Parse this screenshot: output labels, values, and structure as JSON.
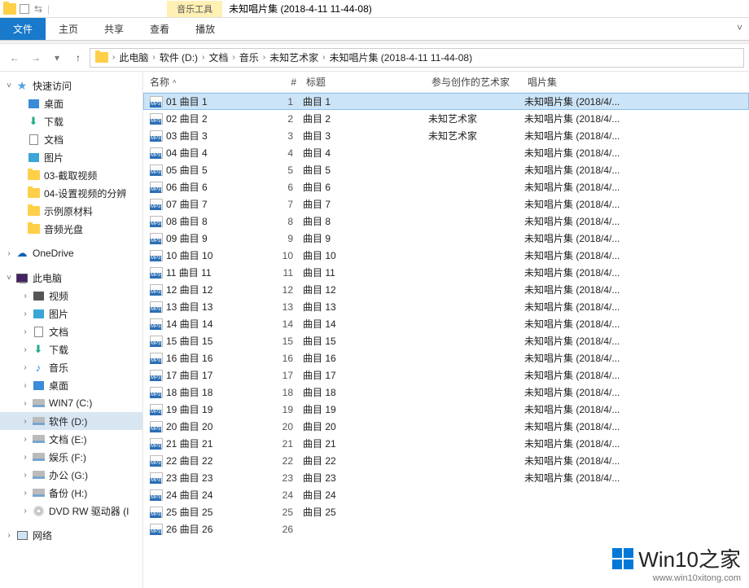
{
  "titlebar": {
    "context_tab": "音乐工具",
    "window_title": "未知唱片集 (2018-4-11 11-44-08)"
  },
  "ribbon": {
    "file": "文件",
    "tabs": [
      "主页",
      "共享",
      "查看",
      "播放"
    ]
  },
  "breadcrumb": [
    "此电脑",
    "软件 (D:)",
    "文档",
    "音乐",
    "未知艺术家",
    "未知唱片集 (2018-4-11 11-44-08)"
  ],
  "columns": {
    "name": "名称",
    "num": "#",
    "title": "标题",
    "artist": "参与创作的艺术家",
    "album": "唱片集"
  },
  "sidebar": {
    "quick": "快速访问",
    "desktop": "桌面",
    "downloads": "下载",
    "documents": "文档",
    "pictures": "图片",
    "f1": "03-截取视频",
    "f2": "04-设置视频的分辨",
    "f3": "示例原材料",
    "f4": "音频光盘",
    "onedrive": "OneDrive",
    "thispc": "此电脑",
    "videos": "视频",
    "pics2": "图片",
    "docs2": "文档",
    "dl2": "下载",
    "music": "音乐",
    "desk2": "桌面",
    "drive_c": "WIN7 (C:)",
    "drive_d": "软件 (D:)",
    "drive_e": "文档 (E:)",
    "drive_f": "娱乐 (F:)",
    "drive_g": "办公 (G:)",
    "drive_h": "备份 (H:)",
    "dvd": "DVD RW 驱动器 (I",
    "network": "网络"
  },
  "files": [
    {
      "name": "01 曲目 1",
      "num": "1",
      "title": "曲目 1",
      "artist": "",
      "album": "未知唱片集 (2018/4/..."
    },
    {
      "name": "02 曲目 2",
      "num": "2",
      "title": "曲目 2",
      "artist": "未知艺术家",
      "album": "未知唱片集 (2018/4/..."
    },
    {
      "name": "03 曲目 3",
      "num": "3",
      "title": "曲目 3",
      "artist": "未知艺术家",
      "album": "未知唱片集 (2018/4/..."
    },
    {
      "name": "04 曲目 4",
      "num": "4",
      "title": "曲目 4",
      "artist": "",
      "album": "未知唱片集 (2018/4/..."
    },
    {
      "name": "05 曲目 5",
      "num": "5",
      "title": "曲目 5",
      "artist": "",
      "album": "未知唱片集 (2018/4/..."
    },
    {
      "name": "06 曲目 6",
      "num": "6",
      "title": "曲目 6",
      "artist": "",
      "album": "未知唱片集 (2018/4/..."
    },
    {
      "name": "07 曲目 7",
      "num": "7",
      "title": "曲目 7",
      "artist": "",
      "album": "未知唱片集 (2018/4/..."
    },
    {
      "name": "08 曲目 8",
      "num": "8",
      "title": "曲目 8",
      "artist": "",
      "album": "未知唱片集 (2018/4/..."
    },
    {
      "name": "09 曲目 9",
      "num": "9",
      "title": "曲目 9",
      "artist": "",
      "album": "未知唱片集 (2018/4/..."
    },
    {
      "name": "10 曲目 10",
      "num": "10",
      "title": "曲目 10",
      "artist": "",
      "album": "未知唱片集 (2018/4/..."
    },
    {
      "name": "11 曲目 11",
      "num": "11",
      "title": "曲目 11",
      "artist": "",
      "album": "未知唱片集 (2018/4/..."
    },
    {
      "name": "12 曲目 12",
      "num": "12",
      "title": "曲目 12",
      "artist": "",
      "album": "未知唱片集 (2018/4/..."
    },
    {
      "name": "13 曲目 13",
      "num": "13",
      "title": "曲目 13",
      "artist": "",
      "album": "未知唱片集 (2018/4/..."
    },
    {
      "name": "14 曲目 14",
      "num": "14",
      "title": "曲目 14",
      "artist": "",
      "album": "未知唱片集 (2018/4/..."
    },
    {
      "name": "15 曲目 15",
      "num": "15",
      "title": "曲目 15",
      "artist": "",
      "album": "未知唱片集 (2018/4/..."
    },
    {
      "name": "16 曲目 16",
      "num": "16",
      "title": "曲目 16",
      "artist": "",
      "album": "未知唱片集 (2018/4/..."
    },
    {
      "name": "17 曲目 17",
      "num": "17",
      "title": "曲目 17",
      "artist": "",
      "album": "未知唱片集 (2018/4/..."
    },
    {
      "name": "18 曲目 18",
      "num": "18",
      "title": "曲目 18",
      "artist": "",
      "album": "未知唱片集 (2018/4/..."
    },
    {
      "name": "19 曲目 19",
      "num": "19",
      "title": "曲目 19",
      "artist": "",
      "album": "未知唱片集 (2018/4/..."
    },
    {
      "name": "20 曲目 20",
      "num": "20",
      "title": "曲目 20",
      "artist": "",
      "album": "未知唱片集 (2018/4/..."
    },
    {
      "name": "21 曲目 21",
      "num": "21",
      "title": "曲目 21",
      "artist": "",
      "album": "未知唱片集 (2018/4/..."
    },
    {
      "name": "22 曲目 22",
      "num": "22",
      "title": "曲目 22",
      "artist": "",
      "album": "未知唱片集 (2018/4/..."
    },
    {
      "name": "23 曲目 23",
      "num": "23",
      "title": "曲目 23",
      "artist": "",
      "album": "未知唱片集 (2018/4/..."
    },
    {
      "name": "24 曲目 24",
      "num": "24",
      "title": "曲目 24",
      "artist": "",
      "album": ""
    },
    {
      "name": "25 曲目 25",
      "num": "25",
      "title": "曲目 25",
      "artist": "",
      "album": ""
    },
    {
      "name": "26 曲目 26",
      "num": "26",
      "title": "",
      "artist": "",
      "album": ""
    }
  ],
  "watermark": {
    "big": "Win10之家",
    "small": "www.win10xitong.com"
  }
}
